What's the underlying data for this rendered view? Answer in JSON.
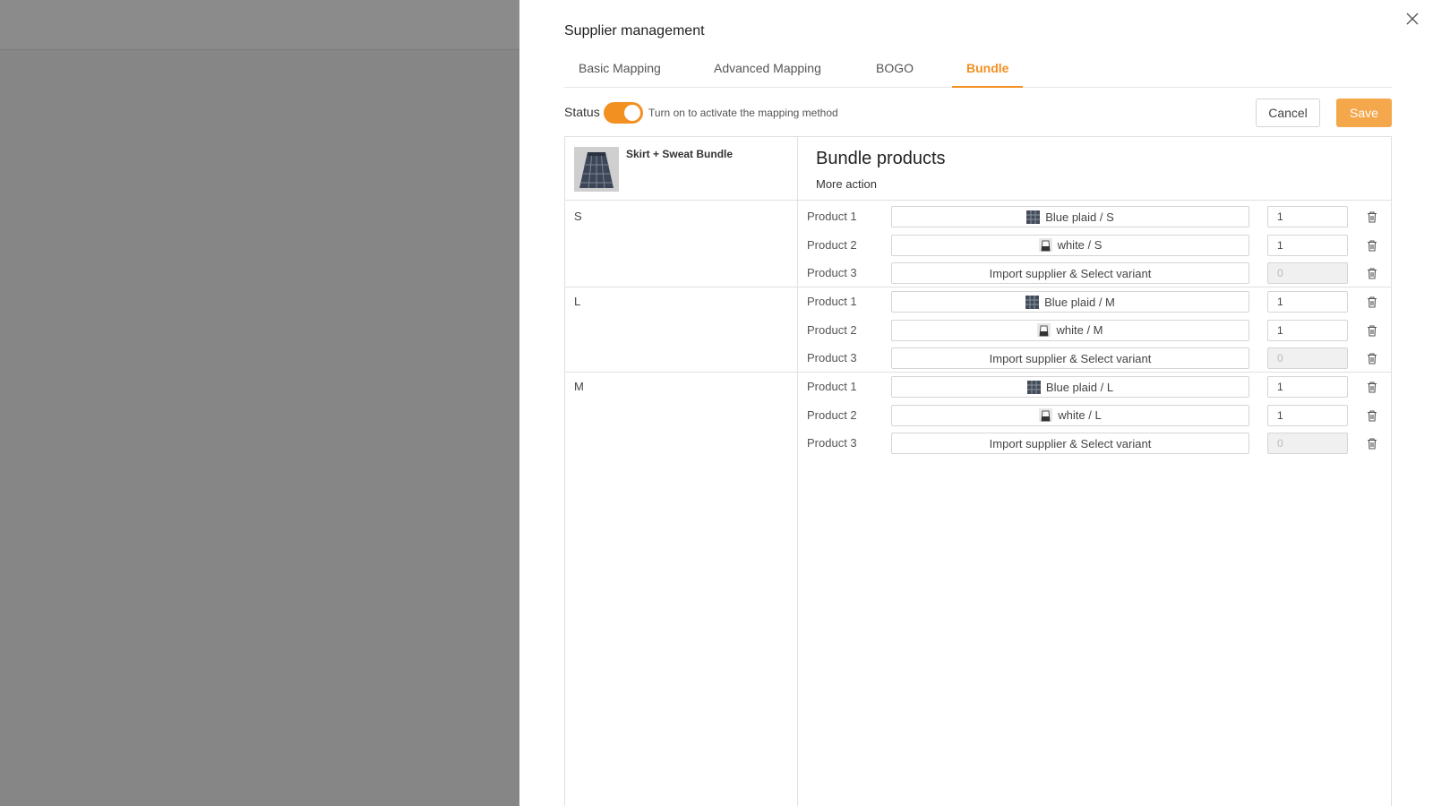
{
  "drawer": {
    "title": "Supplier management",
    "tabs": [
      {
        "label": "Basic Mapping",
        "active": false
      },
      {
        "label": "Advanced Mapping",
        "active": false
      },
      {
        "label": "BOGO",
        "active": false
      },
      {
        "label": "Bundle",
        "active": true
      }
    ],
    "status": {
      "label": "Status",
      "on": true,
      "help": "Turn on to activate the mapping method"
    },
    "cancel_label": "Cancel",
    "save_label": "Save"
  },
  "bundle": {
    "name": "Skirt + Sweat Bundle",
    "panel_title": "Bundle products",
    "more_action": "More action",
    "groups": [
      {
        "size": "S",
        "products": [
          {
            "label": "Product 1",
            "variant": "Blue plaid / S",
            "thumb": "plaid",
            "qty": "1",
            "disabled": false
          },
          {
            "label": "Product 2",
            "variant": "white / S",
            "thumb": "white",
            "qty": "1",
            "disabled": false
          },
          {
            "label": "Product 3",
            "variant": "Import supplier & Select variant",
            "thumb": "",
            "qty": "0",
            "disabled": true
          }
        ]
      },
      {
        "size": "L",
        "products": [
          {
            "label": "Product 1",
            "variant": "Blue plaid / M",
            "thumb": "plaid",
            "qty": "1",
            "disabled": false
          },
          {
            "label": "Product 2",
            "variant": "white / M",
            "thumb": "white",
            "qty": "1",
            "disabled": false
          },
          {
            "label": "Product 3",
            "variant": "Import supplier & Select variant",
            "thumb": "",
            "qty": "0",
            "disabled": true
          }
        ]
      },
      {
        "size": "M",
        "products": [
          {
            "label": "Product 1",
            "variant": "Blue plaid / L",
            "thumb": "plaid",
            "qty": "1",
            "disabled": false
          },
          {
            "label": "Product 2",
            "variant": "white / L",
            "thumb": "white",
            "qty": "1",
            "disabled": false
          },
          {
            "label": "Product 3",
            "variant": "Import supplier & Select variant",
            "thumb": "",
            "qty": "0",
            "disabled": true
          }
        ]
      }
    ]
  },
  "colors": {
    "accent": "#f29021",
    "save_button": "#f5a74b",
    "overlay": "#868686"
  }
}
